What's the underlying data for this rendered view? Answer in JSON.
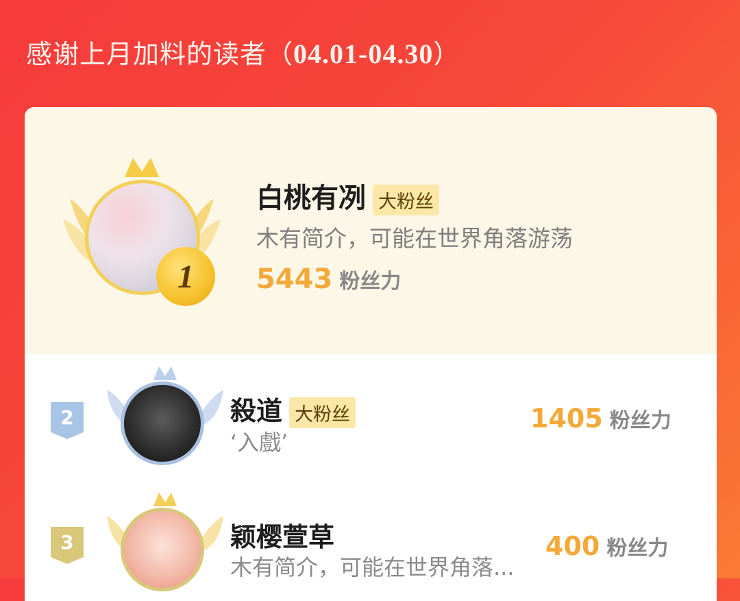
{
  "header": {
    "title_text": "感谢上月加料的读者（",
    "date_range": "04.01-04.30",
    "title_close": "）"
  },
  "ranks": [
    {
      "rank": "1",
      "name": "白桃有冽",
      "tag": "大粉丝",
      "description": "木有简介，可能在世界角落游荡",
      "score": "5443",
      "score_unit": "粉丝力"
    },
    {
      "rank": "2",
      "name": "殺道",
      "tag": "大粉丝",
      "description": "‘入戲’",
      "score": "1405",
      "score_unit": "粉丝力"
    },
    {
      "rank": "3",
      "name": "颖樱萱草",
      "description": "木有简介，可能在世界角落...",
      "score": "400",
      "score_unit": "粉丝力"
    }
  ],
  "colors": {
    "score": "#f3a93a",
    "gold": "#f4cf57",
    "silver": "#a9c0e0",
    "bronze": "#d9c77a"
  }
}
